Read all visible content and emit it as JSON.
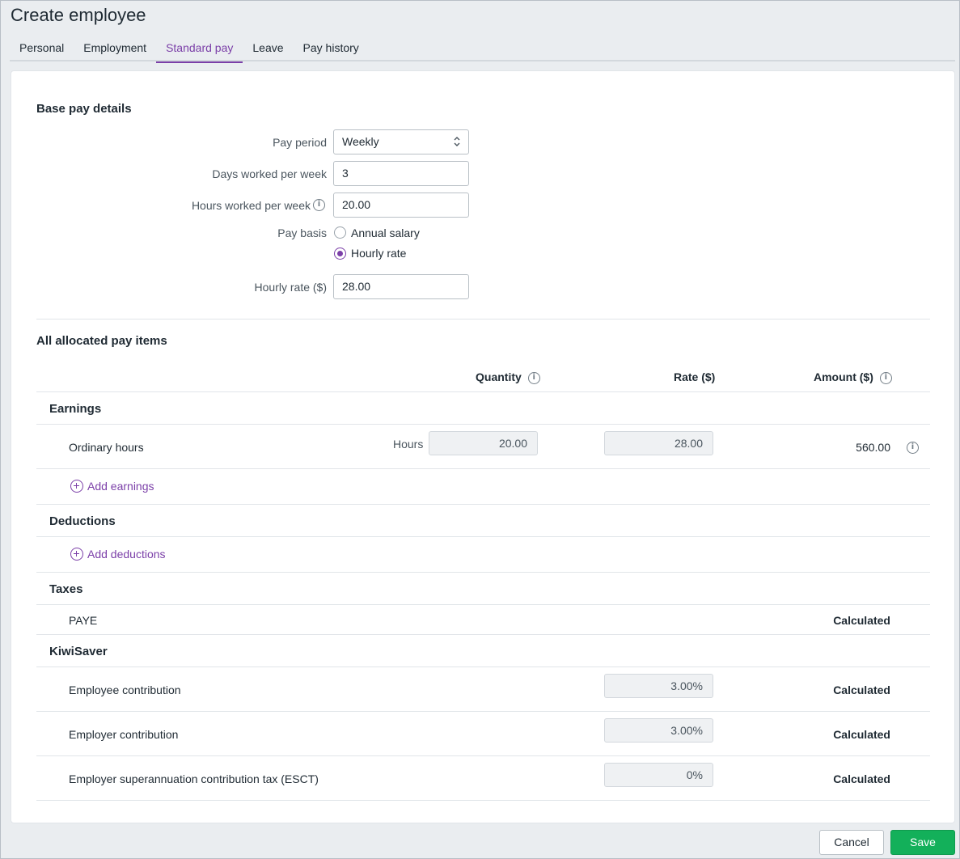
{
  "page": {
    "title": "Create employee"
  },
  "tabs": [
    {
      "label": "Personal"
    },
    {
      "label": "Employment"
    },
    {
      "label": "Standard pay",
      "active": true
    },
    {
      "label": "Leave"
    },
    {
      "label": "Pay history"
    }
  ],
  "base_pay": {
    "heading": "Base pay details",
    "pay_period": {
      "label": "Pay period",
      "value": "Weekly"
    },
    "days_worked": {
      "label": "Days worked per week",
      "value": "3"
    },
    "hours_worked": {
      "label": "Hours worked per week",
      "value": "20.00"
    },
    "pay_basis": {
      "label": "Pay basis",
      "options": [
        {
          "label": "Annual salary",
          "checked": false
        },
        {
          "label": "Hourly rate",
          "checked": true
        }
      ]
    },
    "hourly_rate": {
      "label": "Hourly rate ($)",
      "value": "28.00"
    }
  },
  "pay_items": {
    "heading": "All allocated pay items",
    "columns": {
      "quantity": "Quantity",
      "rate": "Rate ($)",
      "amount": "Amount ($)"
    },
    "earnings": {
      "title": "Earnings",
      "rows": [
        {
          "name": "Ordinary hours",
          "unit": "Hours",
          "quantity": "20.00",
          "rate": "28.00",
          "amount": "560.00"
        }
      ],
      "add_label": "Add earnings"
    },
    "deductions": {
      "title": "Deductions",
      "add_label": "Add deductions"
    },
    "taxes": {
      "title": "Taxes",
      "rows": [
        {
          "name": "PAYE",
          "amount": "Calculated"
        }
      ]
    },
    "kiwisaver": {
      "title": "KiwiSaver",
      "rows": [
        {
          "name": "Employee contribution",
          "rate": "3.00%",
          "amount": "Calculated"
        },
        {
          "name": "Employer contribution",
          "rate": "3.00%",
          "amount": "Calculated"
        },
        {
          "name": "Employer superannuation contribution tax (ESCT)",
          "rate": "0%",
          "amount": "Calculated"
        }
      ]
    }
  },
  "footer": {
    "cancel_label": "Cancel",
    "save_label": "Save"
  },
  "colors": {
    "accent": "#7b3fa8",
    "save": "#13b05a"
  }
}
